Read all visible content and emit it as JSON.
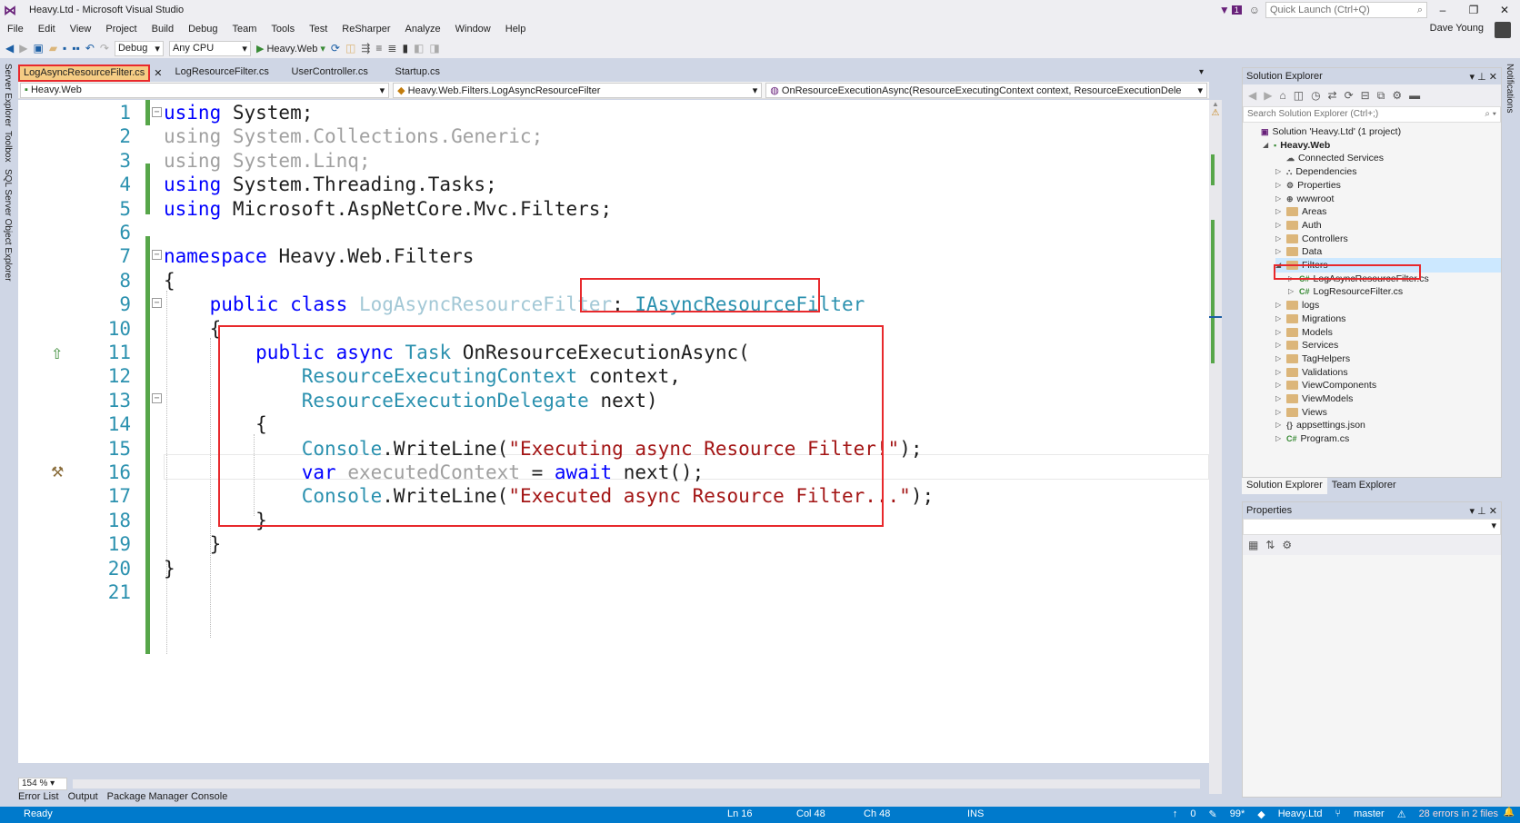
{
  "window": {
    "title": "Heavy.Ltd - Microsoft Visual Studio",
    "notification_count": "1",
    "quick_launch_placeholder": "Quick Launch (Ctrl+Q)",
    "user_name": "Dave Young"
  },
  "menu": [
    "File",
    "Edit",
    "View",
    "Project",
    "Build",
    "Debug",
    "Team",
    "Tools",
    "Test",
    "ReSharper",
    "Analyze",
    "Window",
    "Help"
  ],
  "toolbar": {
    "config": "Debug",
    "platform": "Any CPU",
    "run_target": "Heavy.Web"
  },
  "left_strip": [
    "Server Explorer",
    "Toolbox",
    "SQL Server Object Explorer"
  ],
  "right_strip": [
    "Notifications"
  ],
  "doc_tabs": [
    "LogAsyncResourceFilter.cs",
    "LogResourceFilter.cs",
    "UserController.cs",
    "Startup.cs"
  ],
  "nav": {
    "project": "Heavy.Web",
    "type": "Heavy.Web.Filters.LogAsyncResourceFilter",
    "member": "OnResourceExecutionAsync(ResourceExecutingContext context, ResourceExecutionDele"
  },
  "code_lines": [
    {
      "n": "1",
      "tokens": [
        [
          "kw",
          "using"
        ],
        [
          "",
          " System;"
        ]
      ]
    },
    {
      "n": "2",
      "tokens": [
        [
          "faded",
          "using System.Collections.Generic;"
        ]
      ]
    },
    {
      "n": "3",
      "tokens": [
        [
          "faded",
          "using System.Linq;"
        ]
      ]
    },
    {
      "n": "4",
      "tokens": [
        [
          "kw",
          "using"
        ],
        [
          "",
          " System.Threading.Tasks;"
        ]
      ]
    },
    {
      "n": "5",
      "tokens": [
        [
          "kw",
          "using"
        ],
        [
          "",
          " Microsoft.AspNetCore.Mvc.Filters;"
        ]
      ]
    },
    {
      "n": "6",
      "tokens": []
    },
    {
      "n": "7",
      "tokens": [
        [
          "kw",
          "namespace"
        ],
        [
          "",
          " Heavy.Web.Filters"
        ]
      ]
    },
    {
      "n": "8",
      "tokens": [
        [
          "",
          "{"
        ]
      ]
    },
    {
      "n": "9",
      "tokens": [
        [
          "",
          "    "
        ],
        [
          "kw",
          "public class"
        ],
        [
          "",
          " "
        ],
        [
          "fade-ty",
          "LogAsyncResourceFilter"
        ],
        [
          "",
          ": "
        ],
        [
          "ty",
          "IAsyncResourceFilter"
        ]
      ]
    },
    {
      "n": "10",
      "tokens": [
        [
          "",
          "    {"
        ]
      ]
    },
    {
      "n": "11",
      "tokens": [
        [
          "",
          "        "
        ],
        [
          "kw",
          "public async"
        ],
        [
          "",
          " "
        ],
        [
          "ty",
          "Task"
        ],
        [
          "",
          " OnResourceExecutionAsync("
        ]
      ]
    },
    {
      "n": "12",
      "tokens": [
        [
          "",
          "            "
        ],
        [
          "ty",
          "ResourceExecutingContext"
        ],
        [
          "",
          " context,"
        ]
      ]
    },
    {
      "n": "13",
      "tokens": [
        [
          "",
          "            "
        ],
        [
          "ty",
          "ResourceExecutionDelegate"
        ],
        [
          "",
          " next)"
        ]
      ]
    },
    {
      "n": "14",
      "tokens": [
        [
          "",
          "        {"
        ]
      ]
    },
    {
      "n": "15",
      "tokens": [
        [
          "",
          "            "
        ],
        [
          "ty",
          "Console"
        ],
        [
          "",
          ".WriteLine("
        ],
        [
          "str",
          "\"Executing async Resource Filter!\""
        ],
        [
          "",
          ");"
        ]
      ]
    },
    {
      "n": "16",
      "tokens": [
        [
          "",
          "            "
        ],
        [
          "kw",
          "var"
        ],
        [
          "",
          " "
        ],
        [
          "faded",
          "executedContext"
        ],
        [
          "",
          " = "
        ],
        [
          "kw",
          "await"
        ],
        [
          "",
          " next();"
        ]
      ]
    },
    {
      "n": "17",
      "tokens": [
        [
          "",
          "            "
        ],
        [
          "ty",
          "Console"
        ],
        [
          "",
          ".WriteLine("
        ],
        [
          "str",
          "\"Executed async Resource Filter...\""
        ],
        [
          "",
          ");"
        ]
      ]
    },
    {
      "n": "18",
      "tokens": [
        [
          "",
          "        }"
        ]
      ]
    },
    {
      "n": "19",
      "tokens": [
        [
          "",
          "    }"
        ]
      ]
    },
    {
      "n": "20",
      "tokens": [
        [
          "",
          "}"
        ]
      ]
    },
    {
      "n": "21",
      "tokens": []
    }
  ],
  "zoom": "154 %",
  "solution_explorer": {
    "title": "Solution Explorer",
    "search_placeholder": "Search Solution Explorer (Ctrl+;)",
    "items": [
      {
        "label": "Solution 'Heavy.Ltd' (1 project)",
        "level": 0,
        "kind": "solution"
      },
      {
        "label": "Heavy.Web",
        "level": 1,
        "kind": "project"
      },
      {
        "label": "Connected Services",
        "level": 2,
        "kind": "service"
      },
      {
        "label": "Dependencies",
        "level": 2,
        "kind": "deps"
      },
      {
        "label": "Properties",
        "level": 2,
        "kind": "props"
      },
      {
        "label": "wwwroot",
        "level": 2,
        "kind": "globe"
      },
      {
        "label": "Areas",
        "level": 2,
        "kind": "folder"
      },
      {
        "label": "Auth",
        "level": 2,
        "kind": "folder"
      },
      {
        "label": "Controllers",
        "level": 2,
        "kind": "folder"
      },
      {
        "label": "Data",
        "level": 2,
        "kind": "folder"
      },
      {
        "label": "Filters",
        "level": 2,
        "kind": "folder-open"
      },
      {
        "label": "LogAsyncResourceFilter.cs",
        "level": 3,
        "kind": "cs"
      },
      {
        "label": "LogResourceFilter.cs",
        "level": 3,
        "kind": "cs"
      },
      {
        "label": "logs",
        "level": 2,
        "kind": "folder"
      },
      {
        "label": "Migrations",
        "level": 2,
        "kind": "folder"
      },
      {
        "label": "Models",
        "level": 2,
        "kind": "folder"
      },
      {
        "label": "Services",
        "level": 2,
        "kind": "folder"
      },
      {
        "label": "TagHelpers",
        "level": 2,
        "kind": "folder"
      },
      {
        "label": "Validations",
        "level": 2,
        "kind": "folder"
      },
      {
        "label": "ViewComponents",
        "level": 2,
        "kind": "folder"
      },
      {
        "label": "ViewModels",
        "level": 2,
        "kind": "folder"
      },
      {
        "label": "Views",
        "level": 2,
        "kind": "folder"
      },
      {
        "label": "appsettings.json",
        "level": 2,
        "kind": "json"
      },
      {
        "label": "Program.cs",
        "level": 2,
        "kind": "cs"
      }
    ],
    "tabs": [
      "Solution Explorer",
      "Team Explorer"
    ]
  },
  "properties": {
    "title": "Properties"
  },
  "bottom_tabs": [
    "Error List",
    "Output",
    "Package Manager Console"
  ],
  "status": {
    "state": "Ready",
    "line": "Ln 16",
    "col": "Col 48",
    "ch": "Ch 48",
    "ins": "INS",
    "up_count": "0",
    "edits": "99*",
    "repo": "Heavy.Ltd",
    "branch": "master",
    "errors": "28 errors in 2 files"
  },
  "colors": {
    "accent": "#007acc",
    "highlight_box": "#e8292c",
    "keyword": "#0000ff",
    "type": "#2b91af",
    "string": "#a31515"
  }
}
